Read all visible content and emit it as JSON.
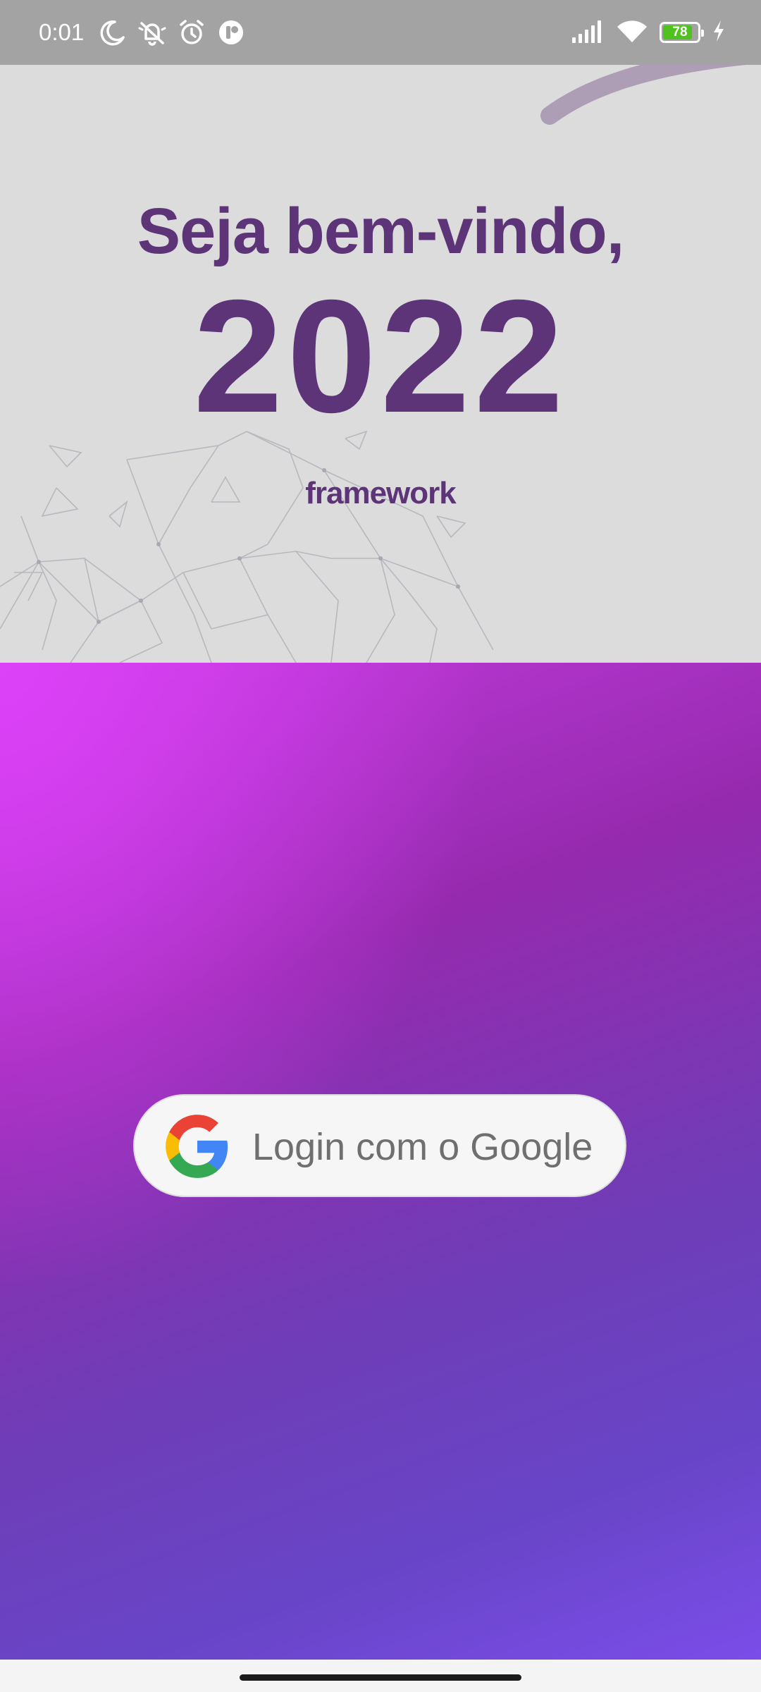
{
  "status_bar": {
    "time": "0:01",
    "left_icons": [
      "moon-icon",
      "notifications-off-icon",
      "alarm-icon",
      "app-notification-icon"
    ],
    "right_icons": [
      "signal-icon",
      "wifi-icon",
      "battery-icon",
      "charging-icon"
    ],
    "battery_level": "78",
    "battery_color": "#4fc21e"
  },
  "banner": {
    "headline": "Seja bem-vindo,",
    "year": "2022",
    "brand": "framework",
    "text_color": "#5c3477",
    "background_color": "#dcdcdc"
  },
  "login": {
    "button_label": "Login com o Google",
    "icon": "google-logo-icon",
    "gradient_colors": [
      "#de42fa",
      "#952aae",
      "#6f3db7",
      "#7b4de9"
    ]
  },
  "nav_bar": {
    "home_indicator": "home-indicator"
  }
}
